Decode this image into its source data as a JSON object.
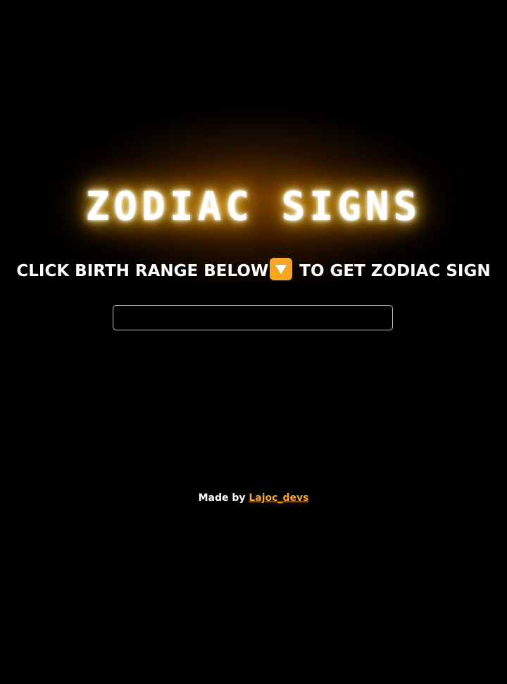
{
  "title": "ZODIAC SIGNS",
  "instruction": {
    "before": "CLICK BIRTH RANGE BELOW",
    "icon": "down-arrow-emoji-icon",
    "after": " TO GET ZODIAC SIGN"
  },
  "range_select": {
    "selected": ""
  },
  "footer": {
    "prefix": "Made by ",
    "link_text": "Lajoc_devs"
  },
  "colors": {
    "background": "#000000",
    "glow": "#ffb300",
    "accent": "#f5a623",
    "text": "#ffffff"
  }
}
